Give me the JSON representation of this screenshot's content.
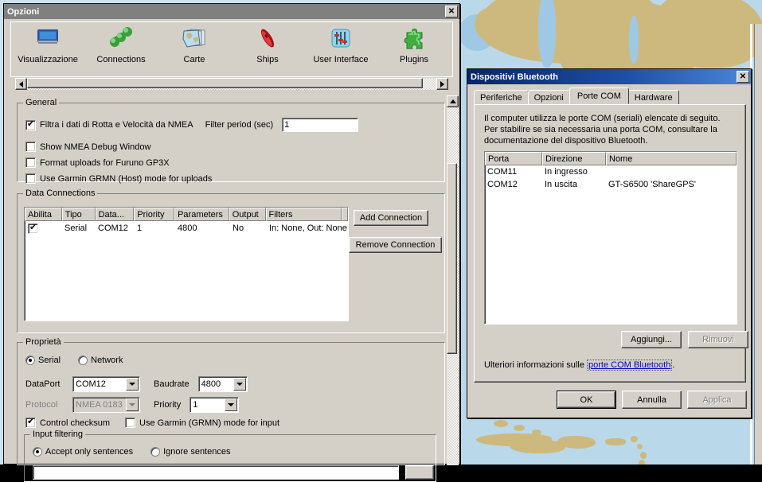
{
  "desktop": {
    "app": "nautical-chart-background"
  },
  "options_window": {
    "title": "Opzioni",
    "close_label": "✕",
    "toolbar": {
      "items": [
        {
          "label": "Visualizzazione",
          "icon": "monitor-icon"
        },
        {
          "label": "Connections",
          "icon": "network-nodes-icon"
        },
        {
          "label": "Carte",
          "icon": "charts-icon"
        },
        {
          "label": "Ships",
          "icon": "ship-icon"
        },
        {
          "label": "User Interface",
          "icon": "sliders-icon"
        },
        {
          "label": "Plugins",
          "icon": "puzzle-piece-icon"
        }
      ]
    },
    "general": {
      "title": "General",
      "filter_nmea_label": "Filtra i dati di Rotta e Velocità da NMEA",
      "filter_nmea_checked": true,
      "filter_period_label": "Filter period (sec)",
      "filter_period_value": "1",
      "show_debug_label": "Show NMEA Debug Window",
      "show_debug_checked": false,
      "furuno_label": "Format uploads for Furuno GP3X",
      "furuno_checked": false,
      "garmin_label": "Use Garmin GRMN (Host) mode for uploads",
      "garmin_checked": false
    },
    "data_connections": {
      "title": "Data Connections",
      "columns": [
        "Abilita",
        "Tipo",
        "Data...",
        "Priority",
        "Parameters",
        "Output",
        "Filters"
      ],
      "rows": [
        {
          "enabled": true,
          "tipo": "Serial",
          "data": "COM12",
          "priority": "1",
          "parameters": "4800",
          "output": "No",
          "filters": "In: None, Out: None"
        }
      ],
      "add_button": "Add Connection",
      "remove_button": "Remove Connection"
    },
    "properties": {
      "title": "Proprietà",
      "serial_label": "Serial",
      "serial_selected": true,
      "network_label": "Network",
      "network_selected": false,
      "dataport_label": "DataPort",
      "dataport_value": "COM12",
      "baudrate_label": "Baudrate",
      "baudrate_value": "4800",
      "protocol_label": "Protocol",
      "protocol_value": "NMEA 0183",
      "protocol_disabled": true,
      "priority_label": "Priority",
      "priority_value": "1",
      "control_checksum_label": "Control checksum",
      "control_checksum_checked": true,
      "garmin_input_label": "Use Garmin (GRMN) mode for input",
      "garmin_input_checked": false
    },
    "input_filtering": {
      "title": "Input filtering",
      "accept_label": "Accept only sentences",
      "accept_selected": true,
      "ignore_label": "Ignore sentences",
      "ignore_selected": false,
      "sentences_value": ""
    }
  },
  "bluetooth_window": {
    "title": "Dispositivi Bluetooth",
    "close_label": "✕",
    "tabs": [
      {
        "label": "Periferiche",
        "active": false
      },
      {
        "label": "Opzioni",
        "active": false
      },
      {
        "label": "Porte COM",
        "active": true
      },
      {
        "label": "Hardware",
        "active": false
      }
    ],
    "description": "Il computer utilizza le porte COM (seriali) elencate di seguito. Per stabilire se sia necessaria una porta COM, consultare la documentazione del dispositivo Bluetooth.",
    "columns": [
      "Porta",
      "Direzione",
      "Nome"
    ],
    "rows": [
      {
        "porta": "COM11",
        "direzione": "In ingresso",
        "nome": ""
      },
      {
        "porta": "COM12",
        "direzione": "In uscita",
        "nome": "GT-S6500 'ShareGPS'"
      }
    ],
    "add_button": "Aggiungi...",
    "remove_button": "Rimuovi",
    "remove_disabled": true,
    "info_prefix": "Ulteriori informazioni sulle ",
    "info_link": "porte COM Bluetooth",
    "info_suffix": ".",
    "ok_button": "OK",
    "cancel_button": "Annulla",
    "apply_button": "Applica",
    "apply_disabled": true
  },
  "colors": {
    "face": "#d4d0c8",
    "active_title": "#0a246a",
    "inactive_title": "#808080",
    "land": "#cdb97e",
    "water": "#cfe3ef",
    "link": "#0000cc"
  }
}
